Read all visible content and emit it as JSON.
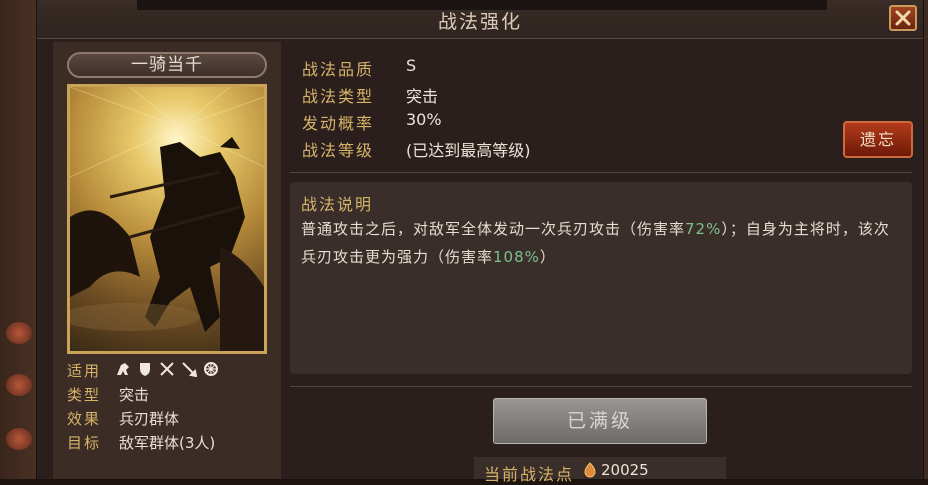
{
  "window": {
    "title": "战法强化"
  },
  "skill": {
    "name": "一骑当千",
    "stats": [
      {
        "label": "适用",
        "value": ""
      },
      {
        "label": "类型",
        "value": "突击"
      },
      {
        "label": "效果",
        "value": "兵刃群体"
      },
      {
        "label": "目标",
        "value": "敌军群体(3人)"
      }
    ],
    "applicable_icons": [
      "cavalry-icon",
      "shield-icon",
      "crossed-swords-icon",
      "spear-icon",
      "wheel-icon"
    ]
  },
  "info": [
    {
      "label": "战法品质",
      "value": "S"
    },
    {
      "label": "战法类型",
      "value": "突击"
    },
    {
      "label": "发动概率",
      "value": "30%"
    },
    {
      "label": "战法等级",
      "value": "(已达到最高等级)"
    }
  ],
  "forget_button": "遗忘",
  "description": {
    "title": "战法说明",
    "text_1": "普通攻击之后，对敌军全体发动一次兵刃攻击（伤害率",
    "highlight_1": "72%",
    "text_2": "）；自身为主将时，该次兵刃攻击更为强力（伤害率",
    "highlight_2": "108%",
    "text_3": "）"
  },
  "max_level_button": "已满级",
  "points": {
    "label": "当前战法点",
    "value": "20025"
  },
  "colors": {
    "label_gold": "#d6b46a",
    "highlight_green": "#7dc08a",
    "forget_red": "#b23a1a"
  }
}
